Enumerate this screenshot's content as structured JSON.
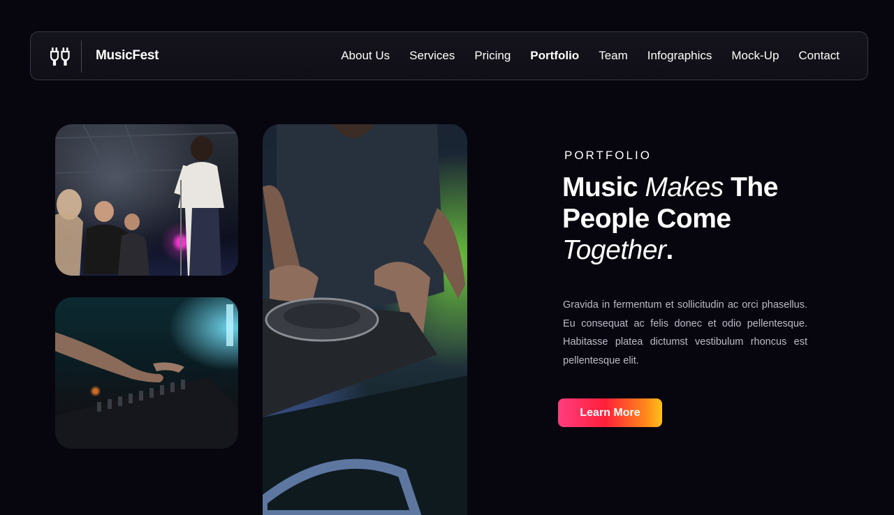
{
  "header": {
    "brand": "MusicFest",
    "nav": [
      {
        "label": "About Us",
        "active": false
      },
      {
        "label": "Services",
        "active": false
      },
      {
        "label": "Pricing",
        "active": false
      },
      {
        "label": "Portfolio",
        "active": true
      },
      {
        "label": "Team",
        "active": false
      },
      {
        "label": "Infographics",
        "active": false
      },
      {
        "label": "Mock-Up",
        "active": false
      },
      {
        "label": "Contact",
        "active": false
      }
    ]
  },
  "portfolio": {
    "eyebrow": "PORTFOLIO",
    "headline": {
      "part1": "Music ",
      "part2": "Makes",
      "part3": " The People Come ",
      "part4": "Together",
      "part5": "."
    },
    "paragraph": "Gravida in fermentum et sollicitudin ac orci phasellus. Eu consequat ac felis donec et odio pellentesque. Habitasse platea dictumst vestibulum rhoncus est pellentesque elit.",
    "cta_label": "Learn More"
  },
  "gallery": [
    {
      "icon": "concert-photo"
    },
    {
      "icon": "dj-mixer-photo"
    },
    {
      "icon": "dj-turntable-photo"
    }
  ],
  "colors": {
    "background": "#07060f",
    "text": "#ffffff",
    "muted_text": "#bdbac5",
    "cta_gradient": [
      "#ff3d7f",
      "#ff1f3a",
      "#ff8a1a",
      "#ffc21a"
    ],
    "nav_border": "#3a3842"
  }
}
